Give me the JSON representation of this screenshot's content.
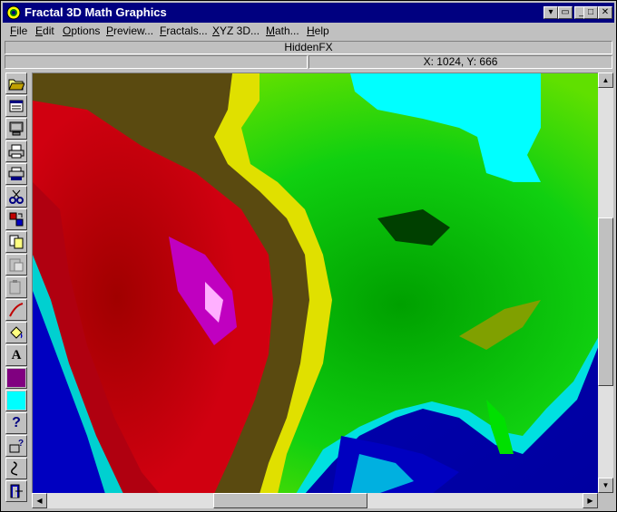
{
  "window": {
    "title": "Fractal 3D Math Graphics",
    "controls": {
      "help": "▾",
      "restore": "▭",
      "minimize": "_",
      "maximize": "□",
      "close": "✕"
    }
  },
  "menu": [
    {
      "label": "File",
      "u": "F",
      "rest": "ile"
    },
    {
      "label": "Edit",
      "u": "E",
      "rest": "dit"
    },
    {
      "label": "Options",
      "u": "O",
      "rest": "ptions"
    },
    {
      "label": "Preview...",
      "u": "P",
      "rest": "review..."
    },
    {
      "label": "Fractals...",
      "u": "F",
      "rest": "ractals..."
    },
    {
      "label": "XYZ 3D...",
      "u": "X",
      "rest": "YZ 3D..."
    },
    {
      "label": "Math...",
      "u": "M",
      "rest": "ath..."
    },
    {
      "label": "Help",
      "u": "H",
      "rest": "elp"
    }
  ],
  "status": {
    "filename": "HiddenFX",
    "coords": "X: 1024, Y: 666"
  },
  "tools": [
    {
      "name": "open-folder-icon"
    },
    {
      "name": "image-window-icon"
    },
    {
      "name": "monitor-icon"
    },
    {
      "name": "printer-icon"
    },
    {
      "name": "printer-setup-icon"
    },
    {
      "name": "cut-icon"
    },
    {
      "name": "palette-transfer-icon"
    },
    {
      "name": "copy-icon"
    },
    {
      "name": "paste-icon"
    },
    {
      "name": "paste-special-icon"
    },
    {
      "name": "draw-line-icon"
    },
    {
      "name": "paint-bucket-icon"
    },
    {
      "name": "text-icon",
      "glyph": "A"
    },
    {
      "name": "primary-color-swatch",
      "color": "#800080"
    },
    {
      "name": "secondary-color-swatch",
      "color": "#00ffff"
    },
    {
      "name": "help-icon",
      "glyph": "?"
    },
    {
      "name": "help-index-icon"
    },
    {
      "name": "script-icon"
    },
    {
      "name": "exit-icon"
    }
  ],
  "colors": {
    "titlebar": "#000080",
    "ocean_deep": "#0000c0",
    "ocean_shelf": "#00ffff",
    "lowland": "#00c000",
    "plain": "#ffff00",
    "highland": "#5a4a00",
    "mountain": "#c00000",
    "peak": "#c000c0"
  }
}
